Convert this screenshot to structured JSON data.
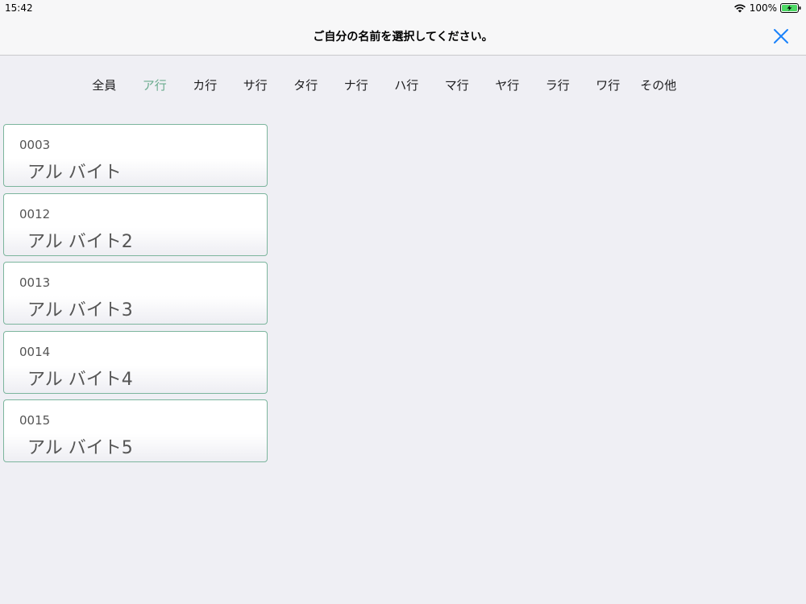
{
  "status": {
    "time": "15:42",
    "battery": "100%"
  },
  "header": {
    "title": "ご自分の名前を選択してください。"
  },
  "tabs": [
    {
      "label": "全員",
      "active": false
    },
    {
      "label": "ア行",
      "active": true
    },
    {
      "label": "カ行",
      "active": false
    },
    {
      "label": "サ行",
      "active": false
    },
    {
      "label": "タ行",
      "active": false
    },
    {
      "label": "ナ行",
      "active": false
    },
    {
      "label": "ハ行",
      "active": false
    },
    {
      "label": "マ行",
      "active": false
    },
    {
      "label": "ヤ行",
      "active": false
    },
    {
      "label": "ラ行",
      "active": false
    },
    {
      "label": "ワ行",
      "active": false
    },
    {
      "label": "その他",
      "active": false
    }
  ],
  "staff": [
    {
      "code": "0003",
      "name": "アル バイト"
    },
    {
      "code": "0012",
      "name": "アル バイト2"
    },
    {
      "code": "0013",
      "name": "アル バイト3"
    },
    {
      "code": "0014",
      "name": "アル バイト4"
    },
    {
      "code": "0015",
      "name": "アル バイト5"
    }
  ],
  "colors": {
    "accent": "#6aab8e",
    "close": "#1a82fb",
    "card_border": "#7cb59d",
    "battery": "#4cd964"
  },
  "icons": {
    "close": "close-icon",
    "wifi": "wifi-icon",
    "battery": "battery-charging-icon"
  }
}
